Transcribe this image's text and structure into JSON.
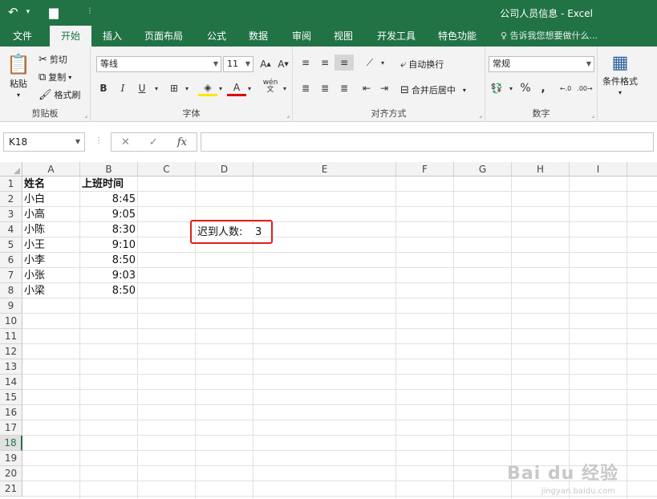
{
  "window": {
    "title": "公司人员信息 - Excel"
  },
  "qat": {
    "undo_icon": "undo-icon",
    "save_icon": "save-icon"
  },
  "tabs": [
    "文件",
    "开始",
    "插入",
    "页面布局",
    "公式",
    "数据",
    "审阅",
    "视图",
    "开发工具",
    "特色功能"
  ],
  "active_tab": "开始",
  "tell_me": "告诉我您想要做什么...",
  "ribbon": {
    "clipboard": {
      "paste": "粘贴",
      "cut": "剪切",
      "copy": "复制",
      "format_painter": "格式刷",
      "label": "剪贴板"
    },
    "font": {
      "name": "等线",
      "size": "11",
      "bold": "B",
      "italic": "I",
      "underline": "U",
      "label": "字体",
      "wen": "wén"
    },
    "alignment": {
      "wrap": "自动换行",
      "merge": "合并后居中",
      "label": "对齐方式"
    },
    "number": {
      "format": "常规",
      "percent": "%",
      "comma": ",",
      "inc": "←.0\n.00",
      "dec": ".00\n→.0",
      "label": "数字"
    },
    "styles": {
      "cond_format": "条件格式"
    }
  },
  "formula_bar": {
    "name_box": "K18",
    "cancel": "✕",
    "enter": "✓",
    "fx": "fx",
    "value": ""
  },
  "columns": [
    "A",
    "B",
    "C",
    "D",
    "E",
    "F",
    "G",
    "H",
    "I"
  ],
  "rows": [
    "1",
    "2",
    "3",
    "4",
    "5",
    "6",
    "7",
    "8",
    "9",
    "10",
    "11",
    "12",
    "13",
    "14",
    "15",
    "16",
    "17",
    "18",
    "19",
    "20",
    "21"
  ],
  "selected_row": "18",
  "cells": {
    "A1": "姓名",
    "B1": "上班时间",
    "A2": "小白",
    "B2": "8:45",
    "A3": "小高",
    "B3": "9:05",
    "A4": "小陈",
    "B4": "8:30",
    "A5": "小王",
    "B5": "9:10",
    "A6": "小李",
    "B6": "8:50",
    "A7": "小张",
    "B7": "9:03",
    "A8": "小梁",
    "B8": "8:50",
    "D4": "迟到人数:",
    "E4": "3"
  },
  "watermark": {
    "brand": "Bai du 经验",
    "url": "jingyan.baidu.com"
  }
}
